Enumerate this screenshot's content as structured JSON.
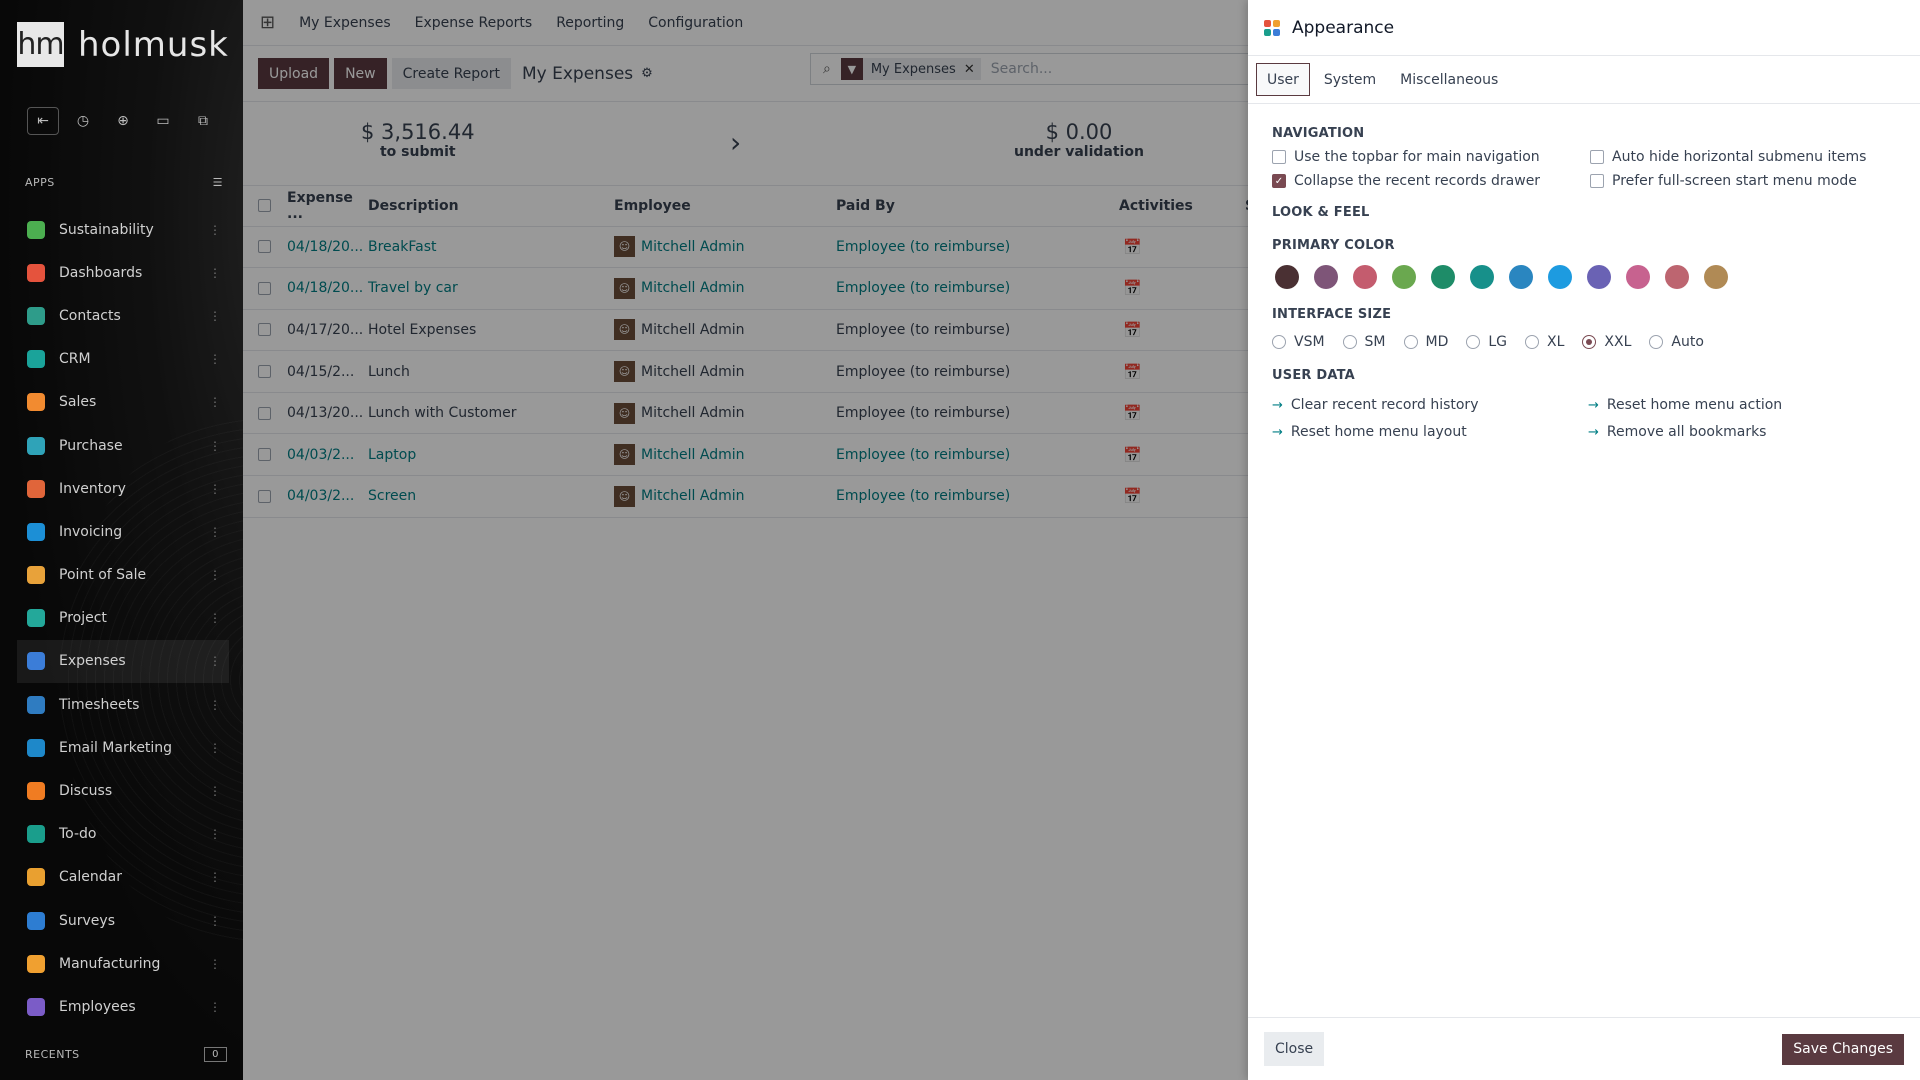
{
  "sidebar": {
    "logo_mark": "hm",
    "logo_text": "holmusk",
    "apps_label": "APPS",
    "recents_label": "RECENTS",
    "recents_count": "0",
    "apps": [
      {
        "label": "Sustainability",
        "color": "#4caf50",
        "icon": "leaf-icon"
      },
      {
        "label": "Dashboards",
        "color": "#e5533d",
        "icon": "dashboard-icon"
      },
      {
        "label": "Contacts",
        "color": "#2e9c8a",
        "icon": "contacts-icon"
      },
      {
        "label": "CRM",
        "color": "#1aa39a",
        "icon": "crm-icon"
      },
      {
        "label": "Sales",
        "color": "#f28b30",
        "icon": "sales-icon"
      },
      {
        "label": "Purchase",
        "color": "#2fa3b8",
        "icon": "purchase-icon"
      },
      {
        "label": "Inventory",
        "color": "#e0653a",
        "icon": "inventory-icon"
      },
      {
        "label": "Invoicing",
        "color": "#1c8fd6",
        "icon": "invoicing-icon"
      },
      {
        "label": "Point of Sale",
        "color": "#e8a23a",
        "icon": "pos-icon"
      },
      {
        "label": "Project",
        "color": "#23a89a",
        "icon": "project-icon"
      },
      {
        "label": "Expenses",
        "color": "#3b7dd8",
        "icon": "expenses-icon"
      },
      {
        "label": "Timesheets",
        "color": "#2f7cc1",
        "icon": "timesheets-icon"
      },
      {
        "label": "Email Marketing",
        "color": "#1e88c9",
        "icon": "email-marketing-icon"
      },
      {
        "label": "Discuss",
        "color": "#f07c22",
        "icon": "discuss-icon"
      },
      {
        "label": "To-do",
        "color": "#1a9e8c",
        "icon": "todo-icon"
      },
      {
        "label": "Calendar",
        "color": "#e9a030",
        "icon": "calendar-icon"
      },
      {
        "label": "Surveys",
        "color": "#2d7dd2",
        "icon": "surveys-icon"
      },
      {
        "label": "Manufacturing",
        "color": "#f0a030",
        "icon": "manufacturing-icon"
      },
      {
        "label": "Employees",
        "color": "#7b5cc7",
        "icon": "employees-icon"
      }
    ],
    "active_app": "Expenses"
  },
  "topnav": {
    "items": [
      "My Expenses",
      "Expense Reports",
      "Reporting",
      "Configuration"
    ]
  },
  "controlbar": {
    "upload": "Upload",
    "new": "New",
    "create_report": "Create Report",
    "view_title": "My Expenses",
    "facet": "My Expenses",
    "search_placeholder": "Search..."
  },
  "summary": {
    "to_submit_amount": "$ 3,516.44",
    "to_submit_label": "to submit",
    "validation_amount": "$ 0.00",
    "validation_label": "under validation"
  },
  "table": {
    "headers": [
      "Expense ...",
      "Description",
      "Employee",
      "Paid By",
      "Activities",
      "S"
    ],
    "rows": [
      {
        "date": "04/18/20...",
        "desc": "BreakFast",
        "emp": "Mitchell Admin",
        "paid": "Employee (to reimburse)",
        "linked": true
      },
      {
        "date": "04/18/20...",
        "desc": "Travel by car",
        "emp": "Mitchell Admin",
        "paid": "Employee (to reimburse)",
        "linked": true
      },
      {
        "date": "04/17/20...",
        "desc": "Hotel Expenses",
        "emp": "Mitchell Admin",
        "paid": "Employee (to reimburse)",
        "linked": false
      },
      {
        "date": "04/15/2...",
        "desc": "Lunch",
        "emp": "Mitchell Admin",
        "paid": "Employee (to reimburse)",
        "linked": false
      },
      {
        "date": "04/13/20...",
        "desc": "Lunch with Customer",
        "emp": "Mitchell Admin",
        "paid": "Employee (to reimburse)",
        "linked": false
      },
      {
        "date": "04/03/2...",
        "desc": "Laptop",
        "emp": "Mitchell Admin",
        "paid": "Employee (to reimburse)",
        "linked": true
      },
      {
        "date": "04/03/2...",
        "desc": "Screen",
        "emp": "Mitchell Admin",
        "paid": "Employee (to reimburse)",
        "linked": true
      }
    ]
  },
  "dialog": {
    "title": "Appearance",
    "tabs": [
      "User",
      "System",
      "Miscellaneous"
    ],
    "active_tab": "User",
    "navigation_title": "NAVIGATION",
    "nav_options": [
      {
        "label": "Use the topbar for main navigation",
        "checked": false
      },
      {
        "label": "Auto hide horizontal submenu items",
        "checked": false
      },
      {
        "label": "Collapse the recent records drawer",
        "checked": true
      },
      {
        "label": "Prefer full-screen start menu mode",
        "checked": false
      }
    ],
    "look_feel_title": "LOOK & FEEL",
    "primary_color_title": "PRIMARY COLOR",
    "primary_colors": [
      "#4a3033",
      "#7e5578",
      "#c45c6e",
      "#6aa84f",
      "#1e8c68",
      "#17908a",
      "#2a86c0",
      "#1d9be0",
      "#6a62b4",
      "#c7628f",
      "#bd6570",
      "#b08a55"
    ],
    "interface_size_title": "INTERFACE SIZE",
    "sizes": [
      "VSM",
      "SM",
      "MD",
      "LG",
      "XL",
      "XXL",
      "Auto"
    ],
    "selected_size": "XXL",
    "user_data_title": "USER DATA",
    "user_data_links": [
      "Clear recent record history",
      "Reset home menu action",
      "Reset home menu layout",
      "Remove all bookmarks"
    ],
    "close": "Close",
    "save": "Save Changes"
  }
}
